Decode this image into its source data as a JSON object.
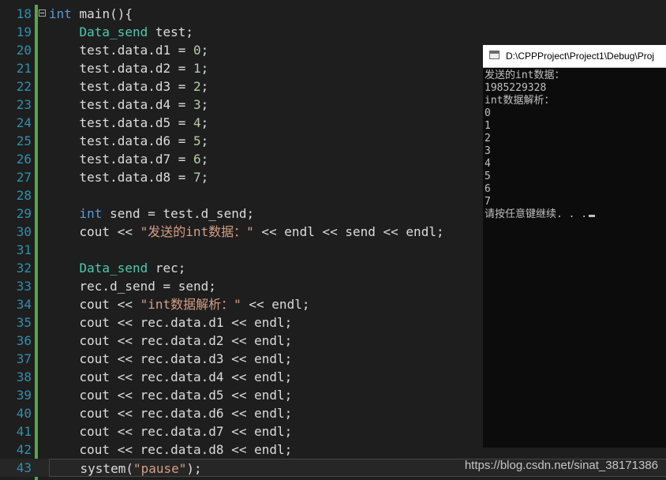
{
  "editor": {
    "lines": [
      {
        "n": "18",
        "t": [
          [
            "kw",
            "int"
          ],
          [
            "p",
            " main(){"
          ]
        ]
      },
      {
        "n": "19",
        "t": [
          [
            "p",
            "    "
          ],
          [
            "ty",
            "Data_send"
          ],
          [
            "p",
            " test;"
          ]
        ]
      },
      {
        "n": "20",
        "t": [
          [
            "p",
            "    test.data.d1 = "
          ],
          [
            "num",
            "0"
          ],
          [
            "p",
            ";"
          ]
        ]
      },
      {
        "n": "21",
        "t": [
          [
            "p",
            "    test.data.d2 = "
          ],
          [
            "num",
            "1"
          ],
          [
            "p",
            ";"
          ]
        ]
      },
      {
        "n": "22",
        "t": [
          [
            "p",
            "    test.data.d3 = "
          ],
          [
            "num",
            "2"
          ],
          [
            "p",
            ";"
          ]
        ]
      },
      {
        "n": "23",
        "t": [
          [
            "p",
            "    test.data.d4 = "
          ],
          [
            "num",
            "3"
          ],
          [
            "p",
            ";"
          ]
        ]
      },
      {
        "n": "24",
        "t": [
          [
            "p",
            "    test.data.d5 = "
          ],
          [
            "num",
            "4"
          ],
          [
            "p",
            ";"
          ]
        ]
      },
      {
        "n": "25",
        "t": [
          [
            "p",
            "    test.data.d6 = "
          ],
          [
            "num",
            "5"
          ],
          [
            "p",
            ";"
          ]
        ]
      },
      {
        "n": "26",
        "t": [
          [
            "p",
            "    test.data.d7 = "
          ],
          [
            "num",
            "6"
          ],
          [
            "p",
            ";"
          ]
        ]
      },
      {
        "n": "27",
        "t": [
          [
            "p",
            "    test.data.d8 = "
          ],
          [
            "num",
            "7"
          ],
          [
            "p",
            ";"
          ]
        ]
      },
      {
        "n": "28",
        "t": []
      },
      {
        "n": "29",
        "t": [
          [
            "p",
            "    "
          ],
          [
            "kw",
            "int"
          ],
          [
            "p",
            " send = test.d_send;"
          ]
        ]
      },
      {
        "n": "30",
        "t": [
          [
            "p",
            "    cout << "
          ],
          [
            "str",
            "\"发送的int数据：\""
          ],
          [
            "p",
            " << endl << send << endl;"
          ]
        ]
      },
      {
        "n": "31",
        "t": []
      },
      {
        "n": "32",
        "t": [
          [
            "p",
            "    "
          ],
          [
            "ty",
            "Data_send"
          ],
          [
            "p",
            " rec;"
          ]
        ]
      },
      {
        "n": "33",
        "t": [
          [
            "p",
            "    rec.d_send = send;"
          ]
        ]
      },
      {
        "n": "34",
        "t": [
          [
            "p",
            "    cout << "
          ],
          [
            "str",
            "\"int数据解析：\""
          ],
          [
            "p",
            " << endl;"
          ]
        ]
      },
      {
        "n": "35",
        "t": [
          [
            "p",
            "    cout << rec.data.d1 << endl;"
          ]
        ]
      },
      {
        "n": "36",
        "t": [
          [
            "p",
            "    cout << rec.data.d2 << endl;"
          ]
        ]
      },
      {
        "n": "37",
        "t": [
          [
            "p",
            "    cout << rec.data.d3 << endl;"
          ]
        ]
      },
      {
        "n": "38",
        "t": [
          [
            "p",
            "    cout << rec.data.d4 << endl;"
          ]
        ]
      },
      {
        "n": "39",
        "t": [
          [
            "p",
            "    cout << rec.data.d5 << endl;"
          ]
        ]
      },
      {
        "n": "40",
        "t": [
          [
            "p",
            "    cout << rec.data.d6 << endl;"
          ]
        ]
      },
      {
        "n": "41",
        "t": [
          [
            "p",
            "    cout << rec.data.d7 << endl;"
          ]
        ]
      },
      {
        "n": "42",
        "t": [
          [
            "p",
            "    cout << rec.data.d8 << endl;"
          ]
        ]
      },
      {
        "n": "43",
        "t": [
          [
            "p",
            "    system("
          ],
          [
            "str",
            "\"pause\""
          ],
          [
            "p",
            ");"
          ]
        ],
        "current": true
      }
    ]
  },
  "console": {
    "title": "D:\\CPPProject\\Project1\\Debug\\Proj",
    "output": [
      "发送的int数据：",
      "1985229328",
      "int数据解析：",
      "0",
      "1",
      "2",
      "3",
      "4",
      "5",
      "6",
      "7",
      "请按任意键继续. . ."
    ]
  },
  "watermark": "https://blog.csdn.net/sinat_38171386",
  "colors": {
    "background": "#1e1e1e",
    "line_number": "#2b91af",
    "keyword": "#569cd6",
    "type": "#4ec9b0",
    "string": "#d69d85",
    "number": "#b5cea8",
    "text": "#dcdcdc",
    "console_bg": "#0c0c0c",
    "console_text": "#c0c0c0"
  }
}
